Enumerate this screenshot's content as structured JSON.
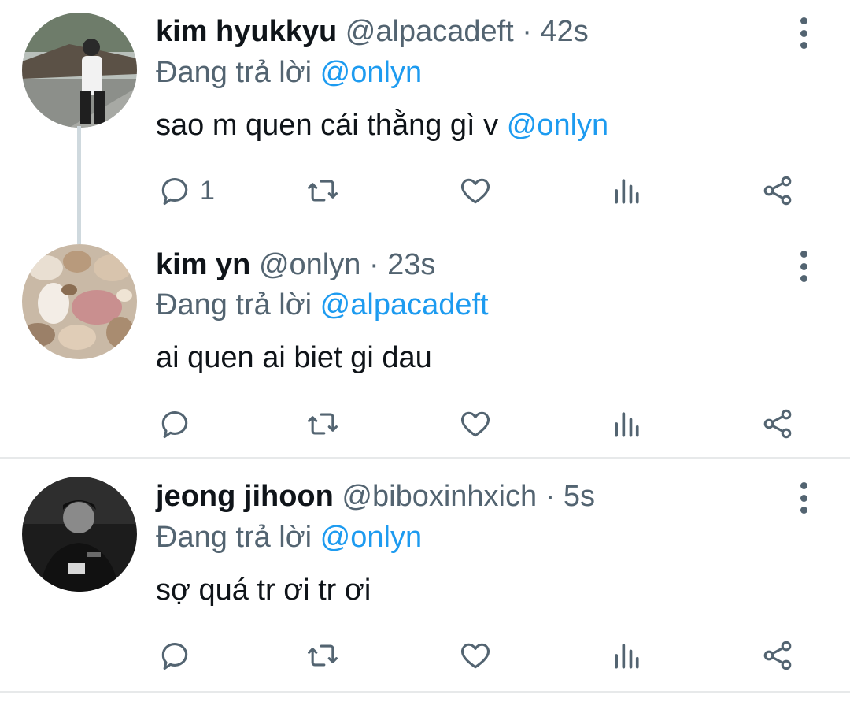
{
  "tweets": [
    {
      "name": "kim hyukkyu",
      "handle": "@alpacadeft",
      "separator": "·",
      "time": "42s",
      "reply_prefix": "Đang trả lời",
      "reply_to": "@onlyn",
      "text": "sao m quen cái thằng gì v",
      "text_mention": "@onlyn",
      "reply_count": "1"
    },
    {
      "name": "kim yn",
      "handle": "@onlyn",
      "separator": "·",
      "time": "23s",
      "reply_prefix": "Đang trả lời",
      "reply_to": "@alpacadeft",
      "text": "ai quen ai biet gi dau",
      "reply_count": ""
    },
    {
      "name": "jeong jihoon",
      "handle": "@biboxinhxich",
      "separator": "·",
      "time": "5s",
      "reply_prefix": "Đang trả lời",
      "reply_to": "@onlyn",
      "text": "sợ quá tr ơi tr ơi",
      "reply_count": ""
    }
  ],
  "icons": {
    "reply": "reply-icon",
    "retweet": "retweet-icon",
    "like": "heart-icon",
    "views": "views-icon",
    "share": "share-icon",
    "more": "more-vertical-icon"
  },
  "colors": {
    "text": "#0f1419",
    "secondary": "#536471",
    "accent": "#1d9bf0",
    "divider": "#e7e9ea",
    "thread_line": "#cfd9de"
  }
}
